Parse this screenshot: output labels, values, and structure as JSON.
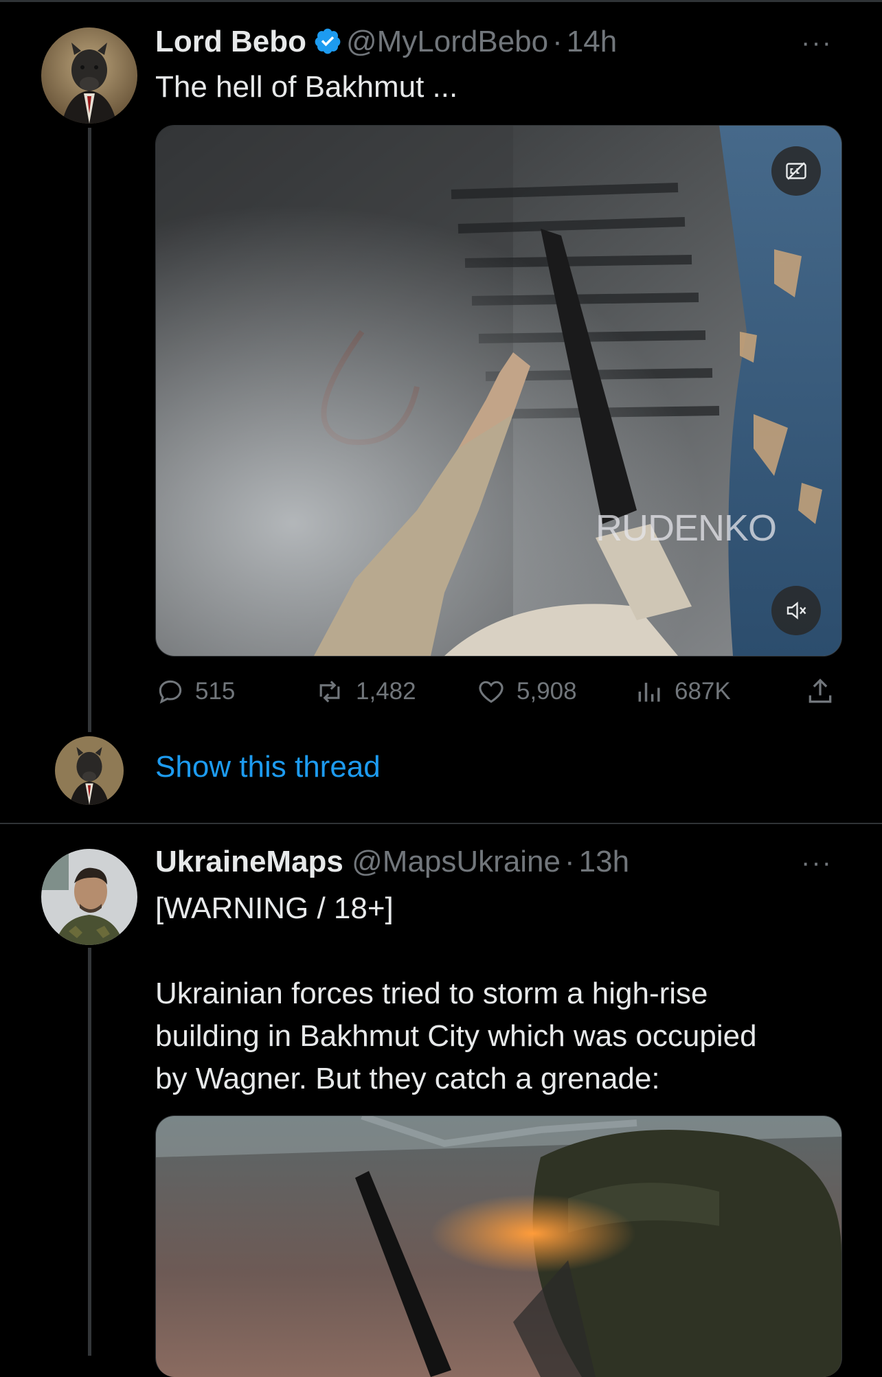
{
  "tweets": [
    {
      "name": "Lord Bebo",
      "handle": "@MyLordBebo",
      "separator": "·",
      "time": "14h",
      "text": "The hell of Bakhmut ...",
      "media": {
        "watermark": "RUDENKO"
      },
      "stats": {
        "replies": "515",
        "retweets": "1,482",
        "likes": "5,908",
        "views": "687K"
      }
    },
    {
      "name": "UkraineMaps",
      "handle": "@MapsUkraine",
      "separator": "·",
      "time": "13h",
      "text_lines": [
        "[WARNING / 18+]",
        "Ukrainian forces tried to storm a high-rise",
        "building in Bakhmut City which was occupied",
        "by Wagner. But they catch a grenade:"
      ]
    }
  ],
  "thread": {
    "show_label": "Show this thread"
  },
  "more_label": "···",
  "icons": {
    "verified": "verified-badge-icon",
    "reply": "reply-icon",
    "retweet": "retweet-icon",
    "like": "heart-icon",
    "views": "views-icon",
    "share": "share-icon",
    "captions": "captions-icon",
    "mute": "mute-icon"
  },
  "colors": {
    "accent": "#1d9bf0",
    "muted": "#71767b",
    "background": "#000000"
  }
}
